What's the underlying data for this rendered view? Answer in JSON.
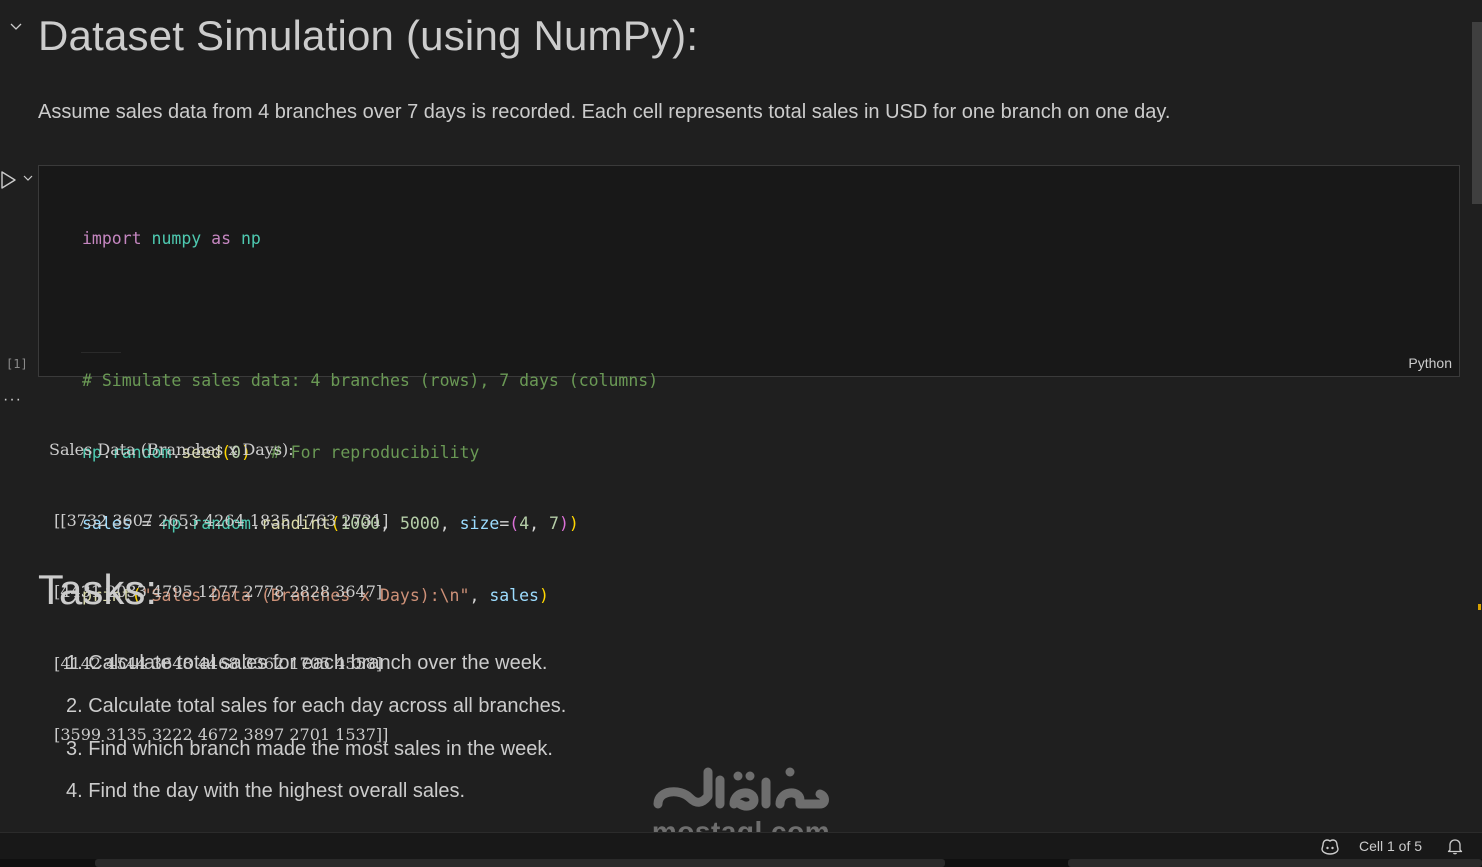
{
  "markdown_cell_1": {
    "heading": "Dataset Simulation (using NumPy):",
    "paragraph": "Assume sales data from 4 branches over 7 days is recorded. Each cell represents total sales in USD for one branch on one day."
  },
  "code_cell": {
    "execution_count": "[1]",
    "language": "Python",
    "lines": [
      "import numpy as np",
      "",
      "# Simulate sales data: 4 branches (rows), 7 days (columns)",
      "np.random.seed(0)  # For reproducibility",
      "sales = np.random.randint(1000, 5000, size=(4, 7))",
      "print(\"Sales Data (Branches x Days):\\n\", sales)"
    ],
    "tokens": {
      "import": "import",
      "numpy": "numpy",
      "as": "as",
      "np": "np",
      "comment1": "# Simulate sales data: 4 branches (rows), 7 days (columns)",
      "seed_obj": "np",
      "random": "random",
      "seed": "seed",
      "seed_arg": "0",
      "comment2": "# For reproducibility",
      "sales": "sales",
      "randint": "randint",
      "arg1": "1000",
      "arg2": "5000",
      "size_kw": "size",
      "dim1": "4",
      "dim2": "7",
      "print": "print",
      "string": "\"Sales Data (Branches x Days):\\n\""
    }
  },
  "output": {
    "menu_icon": "ellipsis-icon",
    "lines": [
      "Sales Data (Branches x Days):",
      " [[3732 3607 2653 4264 1835 1763 2731]",
      " [4431 2033 4795 1277 2778 2828 3647]",
      " [4142 4544 3648 4468 3362 1705 4558]",
      " [3599 3135 3222 4672 3897 2701 1537]]"
    ]
  },
  "markdown_cell_2": {
    "heading": "Tasks:",
    "tasks": [
      "1. Calculate total sales for each branch over the week.",
      "2. Calculate total sales for each day across all branches.",
      "3. Find which branch made the most sales in the week.",
      "4. Find the day with the highest overall sales."
    ]
  },
  "watermark": {
    "arabic": "مستقل",
    "domain": "mostaql.com"
  },
  "status_bar": {
    "cell_indicator": "Cell 1 of 5",
    "copilot_icon": "copilot-icon",
    "bell_icon": "bell-icon"
  },
  "colors": {
    "background": "#1f1f1f",
    "code_background": "#181818",
    "keyword": "#c586c0",
    "module": "#4ec9b0",
    "variable": "#9cdcfe",
    "function": "#dcdcaa",
    "number": "#b5cea8",
    "string": "#ce9178",
    "comment": "#6a9955"
  }
}
